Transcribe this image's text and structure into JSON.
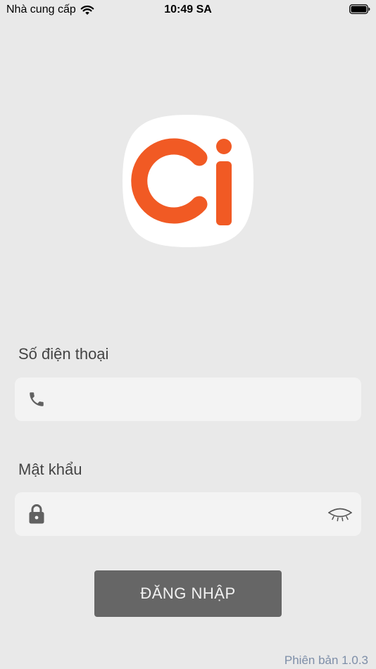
{
  "status_bar": {
    "carrier": "Nhà cung cấp",
    "time": "10:49 SA"
  },
  "logo": {
    "icon": "ci-logo",
    "accent_color": "#f15a24"
  },
  "login_form": {
    "phone_label": "Số điện thoại",
    "phone_value": "",
    "phone_icon": "phone-icon",
    "password_label": "Mật khẩu",
    "password_value": "",
    "lock_icon": "lock-icon",
    "visibility_icon": "eye-closed-icon",
    "submit_label": "ĐĂNG NHẬP"
  },
  "footer": {
    "version": "Phiên bản 1.0.3"
  },
  "colors": {
    "background": "#e9e9e9",
    "input_background": "#f3f3f3",
    "button_background": "#666666",
    "version_text": "#7d8ea8"
  }
}
